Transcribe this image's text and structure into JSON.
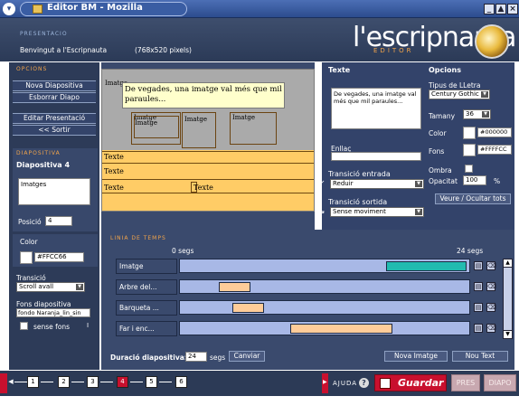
{
  "window": {
    "title": "Editor BM - Mozilla"
  },
  "header": {
    "section": "PRESENTACIO",
    "welcome": "Benvingut a l'Escripnauta",
    "resolution": "(768x520 pixels)",
    "logo": "l'escripnauta",
    "logo_sub": "EDITOR"
  },
  "left": {
    "options_title": "OPCIONS",
    "new_slide": "Nova Diapositiva",
    "delete_slide": "Esborrar Diapo",
    "edit_presentation": "Editar Presentació",
    "exit": "<< Sortir",
    "slide_section": "DIAPOSITIVA",
    "slide_name": "Diapositiva 4",
    "slide_field": "Imatges",
    "position_label": "Posició",
    "position_value": "4",
    "color_label": "Color",
    "color_value": "#FFCC66",
    "transition_label": "Transició",
    "transition_value": "Scroll avall",
    "bg_label": "Fons diapositiva",
    "bg_value": "fondo Naranja_lin_sin",
    "no_bg_label": "sense fons",
    "no_bg_marker": "I"
  },
  "canvas": {
    "imatge_label": "Imatge",
    "caption": "De vegades, una imatge val més que mil paraules...",
    "imatge_boxes": [
      "Imatge",
      "Imatge",
      "Imatge",
      "Imatge"
    ],
    "text_rows": [
      "Texte",
      "Texte",
      "Texte"
    ],
    "text_row3_right": "Texte"
  },
  "right": {
    "text_title": "Texte",
    "text_preview": "De vegades, una imatge val més que mil paraules...",
    "link_label": "Enllaç",
    "options_title": "Opcions",
    "font_type_label": "Tipus de LLetra",
    "font_value": "Century Gothic",
    "size_label": "Tamany",
    "size_value": "36",
    "color_label": "Color",
    "color_value": "#000000",
    "bg_label": "Fons",
    "bg_value": "#FFFFCC",
    "shadow_label": "Ombra",
    "opacity_label": "Opacitat",
    "opacity_value": "100",
    "opacity_unit": "%",
    "entry_label": "Transició entrada",
    "entry_value": "Reduir",
    "exit_label": "Transició sortida",
    "exit_value": "Sense moviment",
    "toggle_all": "Veure / Ocultar tots"
  },
  "timeline": {
    "title": "LINIA DE TEMPS",
    "start": "0 segs",
    "end": "24 segs",
    "rows": [
      {
        "label": "Imatge",
        "seg_start": 0.712,
        "seg_end": 0.99,
        "seg_color": "#22bbb0"
      },
      {
        "label": "Arbre del...",
        "seg_start": 0.134,
        "seg_end": 0.243,
        "seg_color": "#ffcc99"
      },
      {
        "label": "Barqueta ...",
        "seg_start": 0.18,
        "seg_end": 0.29,
        "seg_color": "#ffcc99"
      },
      {
        "label": "Far i enc...",
        "seg_start": 0.38,
        "seg_end": 0.735,
        "seg_color": "#ffcc99"
      }
    ],
    "row1_label": "Imatge",
    "row2_label": "Arbre del...",
    "row3_label": "Barqueta ...",
    "row4_label": "Far i enc...",
    "duration_label": "Duració diapositiva:",
    "duration_value": "24",
    "duration_unit": "segs",
    "change": "Canviar",
    "new_image": "Nova Imatge",
    "new_text": "Nou Text"
  },
  "steps": {
    "items": [
      "1",
      "2",
      "3",
      "4",
      "5",
      "6"
    ],
    "active": "4"
  },
  "footer": {
    "help": "AJUDA",
    "save": "Guardar",
    "pres": "PRES",
    "diapo": "DIAPO"
  },
  "colors": {
    "accent": "#f2a44a",
    "canvas": "#ffcc66",
    "save_red": "#c8102e",
    "panel": "#33436a"
  }
}
